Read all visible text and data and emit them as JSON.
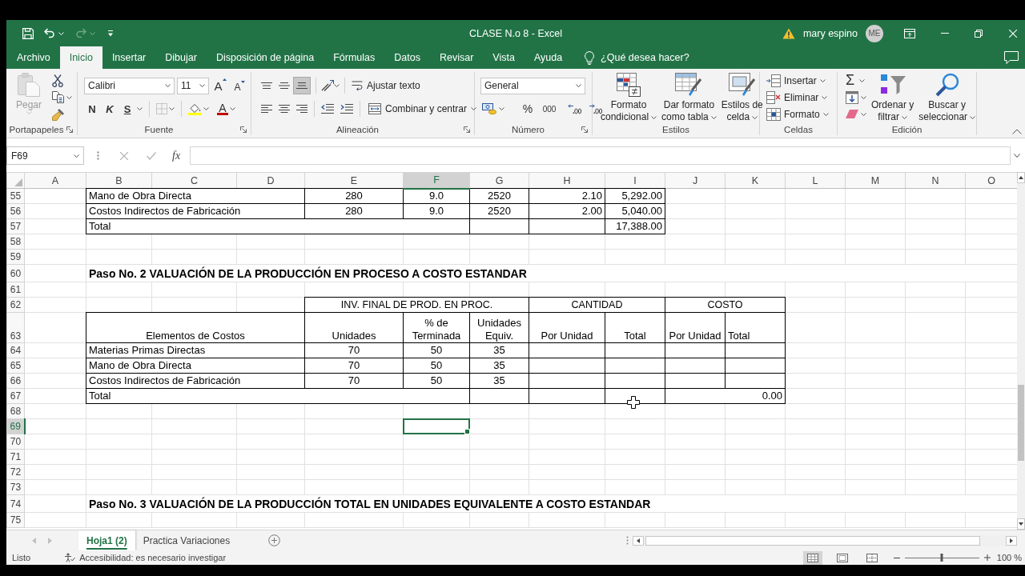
{
  "window": {
    "title": "CLASE N.o 8 - Excel",
    "user": "mary espino",
    "avatar": "ME"
  },
  "ribbon_tabs": [
    {
      "label": "Archivo",
      "selected": false
    },
    {
      "label": "Inicio",
      "selected": true
    },
    {
      "label": "Insertar",
      "selected": false
    },
    {
      "label": "Dibujar",
      "selected": false
    },
    {
      "label": "Disposición de página",
      "selected": false
    },
    {
      "label": "Fórmulas",
      "selected": false
    },
    {
      "label": "Datos",
      "selected": false
    },
    {
      "label": "Revisar",
      "selected": false
    },
    {
      "label": "Vista",
      "selected": false
    },
    {
      "label": "Ayuda",
      "selected": false
    }
  ],
  "tell_me": {
    "placeholder": "¿Qué desea hacer?"
  },
  "ribbon": {
    "clipboard": {
      "label": "Portapapeles",
      "paste": {
        "label": "Pegar",
        "disabled": true
      }
    },
    "font": {
      "label": "Fuente",
      "font_name": "Calibri",
      "font_size": "11",
      "grow": "A",
      "shrink": "A",
      "bold": "N",
      "italic": "K",
      "underline": "S",
      "font_color": "A"
    },
    "alignment": {
      "label": "Alineación",
      "vertical_align": [
        {
          "kind": "top",
          "selected": false
        },
        {
          "kind": "middle",
          "selected": false
        },
        {
          "kind": "bottom",
          "selected": true
        }
      ],
      "wrap_text": "Ajustar texto",
      "merge": "Combinar y centrar"
    },
    "number": {
      "label": "Número",
      "format": "General",
      "percent": "%",
      "thousands": "000"
    },
    "styles": {
      "label": "Estilos",
      "buttons": [
        {
          "kind": "conditional",
          "lines": [
            "Formato",
            "condicional"
          ]
        },
        {
          "kind": "table",
          "lines": [
            "Dar formato",
            "como tabla"
          ]
        },
        {
          "kind": "cell",
          "lines": [
            "Estilos de",
            "celda"
          ]
        }
      ]
    },
    "cells": {
      "label": "Celdas",
      "buttons": [
        {
          "kind": "insert",
          "label": "Insertar"
        },
        {
          "kind": "delete",
          "label": "Eliminar"
        },
        {
          "kind": "format",
          "label": "Formato"
        }
      ]
    },
    "editing": {
      "label": "Edición",
      "autosum": "Σ",
      "buttons": [
        {
          "kind": "sort",
          "lines": [
            "Ordenar y",
            "filtrar"
          ]
        },
        {
          "kind": "find",
          "lines": [
            "Buscar y",
            "seleccionar"
          ]
        }
      ]
    }
  },
  "formula_bar": {
    "name_box": "F69",
    "function_button": "fx"
  },
  "sheet": {
    "columns": [
      {
        "label": "A",
        "selected": false
      },
      {
        "label": "B",
        "selected": false
      },
      {
        "label": "C",
        "selected": false
      },
      {
        "label": "D",
        "selected": false
      },
      {
        "label": "E",
        "selected": false
      },
      {
        "label": "F",
        "selected": true
      },
      {
        "label": "G",
        "selected": false
      },
      {
        "label": "H",
        "selected": false
      },
      {
        "label": "I",
        "selected": false
      },
      {
        "label": "J",
        "selected": false
      },
      {
        "label": "K",
        "selected": false
      },
      {
        "label": "L",
        "selected": false
      },
      {
        "label": "M",
        "selected": false
      },
      {
        "label": "N",
        "selected": false
      },
      {
        "label": "O",
        "selected": false
      }
    ],
    "rows": [
      {
        "number": "55",
        "selected": false,
        "kind": "cost_row",
        "label": "Mano de Obra Directa",
        "values": [
          "280",
          "9.0",
          "2520",
          "2.10",
          "5,292.00"
        ]
      },
      {
        "number": "56",
        "selected": false,
        "kind": "cost_row",
        "label": "Costos Indirectos de Fabricación",
        "values": [
          "280",
          "9.0",
          "2520",
          "2.00",
          "5,040.00"
        ]
      },
      {
        "number": "57",
        "selected": false,
        "kind": "cost_total",
        "label": "Total",
        "total": "17,388.00"
      },
      {
        "number": "58",
        "selected": false,
        "kind": "blank"
      },
      {
        "number": "59",
        "selected": false,
        "kind": "blank"
      },
      {
        "number": "60",
        "selected": false,
        "kind": "heading",
        "text": "Paso No. 2 VALUACIÓN DE LA PRODUCCIÓN EN PROCESO A COSTO ESTANDAR"
      },
      {
        "number": "61",
        "selected": false,
        "kind": "blank"
      },
      {
        "number": "62",
        "selected": false,
        "kind": "group_header",
        "groups": [
          "INV. FINAL DE PROD. EN PROC.",
          "CANTIDAD",
          "COSTO"
        ]
      },
      {
        "number": "63",
        "selected": false,
        "kind": "column_header",
        "label": "Elementos de Costos",
        "values": [
          "Unidades",
          "% de Terminada",
          "Unidades Equiv.",
          "Por Unidad",
          "Total",
          "Por Unidad",
          "Total"
        ]
      },
      {
        "number": "64",
        "selected": false,
        "kind": "inventory_row",
        "label": "Materias Primas Directas",
        "values": [
          "70",
          "50",
          "35"
        ]
      },
      {
        "number": "65",
        "selected": false,
        "kind": "inventory_row",
        "label": "Mano de Obra Directa",
        "values": [
          "70",
          "50",
          "35"
        ]
      },
      {
        "number": "66",
        "selected": false,
        "kind": "inventory_row",
        "label": "Costos Indirectos de Fabricación",
        "values": [
          "70",
          "50",
          "35"
        ]
      },
      {
        "number": "67",
        "selected": false,
        "kind": "inventory_total",
        "label": "Total",
        "total": "0.00"
      },
      {
        "number": "68",
        "selected": false,
        "kind": "blank"
      },
      {
        "number": "69",
        "selected": true,
        "kind": "blank"
      },
      {
        "number": "70",
        "selected": false,
        "kind": "blank"
      },
      {
        "number": "71",
        "selected": false,
        "kind": "blank"
      },
      {
        "number": "72",
        "selected": false,
        "kind": "blank"
      },
      {
        "number": "73",
        "selected": false,
        "kind": "blank"
      },
      {
        "number": "74",
        "selected": false,
        "kind": "heading",
        "text": "Paso No. 3 VALUACIÓN DE LA PRODUCCIÓN TOTAL EN UNIDADES EQUIVALENTE A COSTO ESTANDAR"
      },
      {
        "number": "75",
        "selected": false,
        "kind": "blank"
      }
    ]
  },
  "sheet_tabs": [
    {
      "label": "Hoja1 (2)",
      "selected": true
    },
    {
      "label": "Practica Variaciones",
      "selected": false
    }
  ],
  "status_bar": {
    "mode": "Listo",
    "accessibility": "Accesibilidad: es necesario investigar",
    "views": [
      {
        "kind": "normal",
        "selected": true
      },
      {
        "kind": "page_layout",
        "selected": false
      },
      {
        "kind": "page_break",
        "selected": false
      }
    ],
    "zoom": {
      "level": 0.5,
      "reading": "100 %"
    }
  }
}
